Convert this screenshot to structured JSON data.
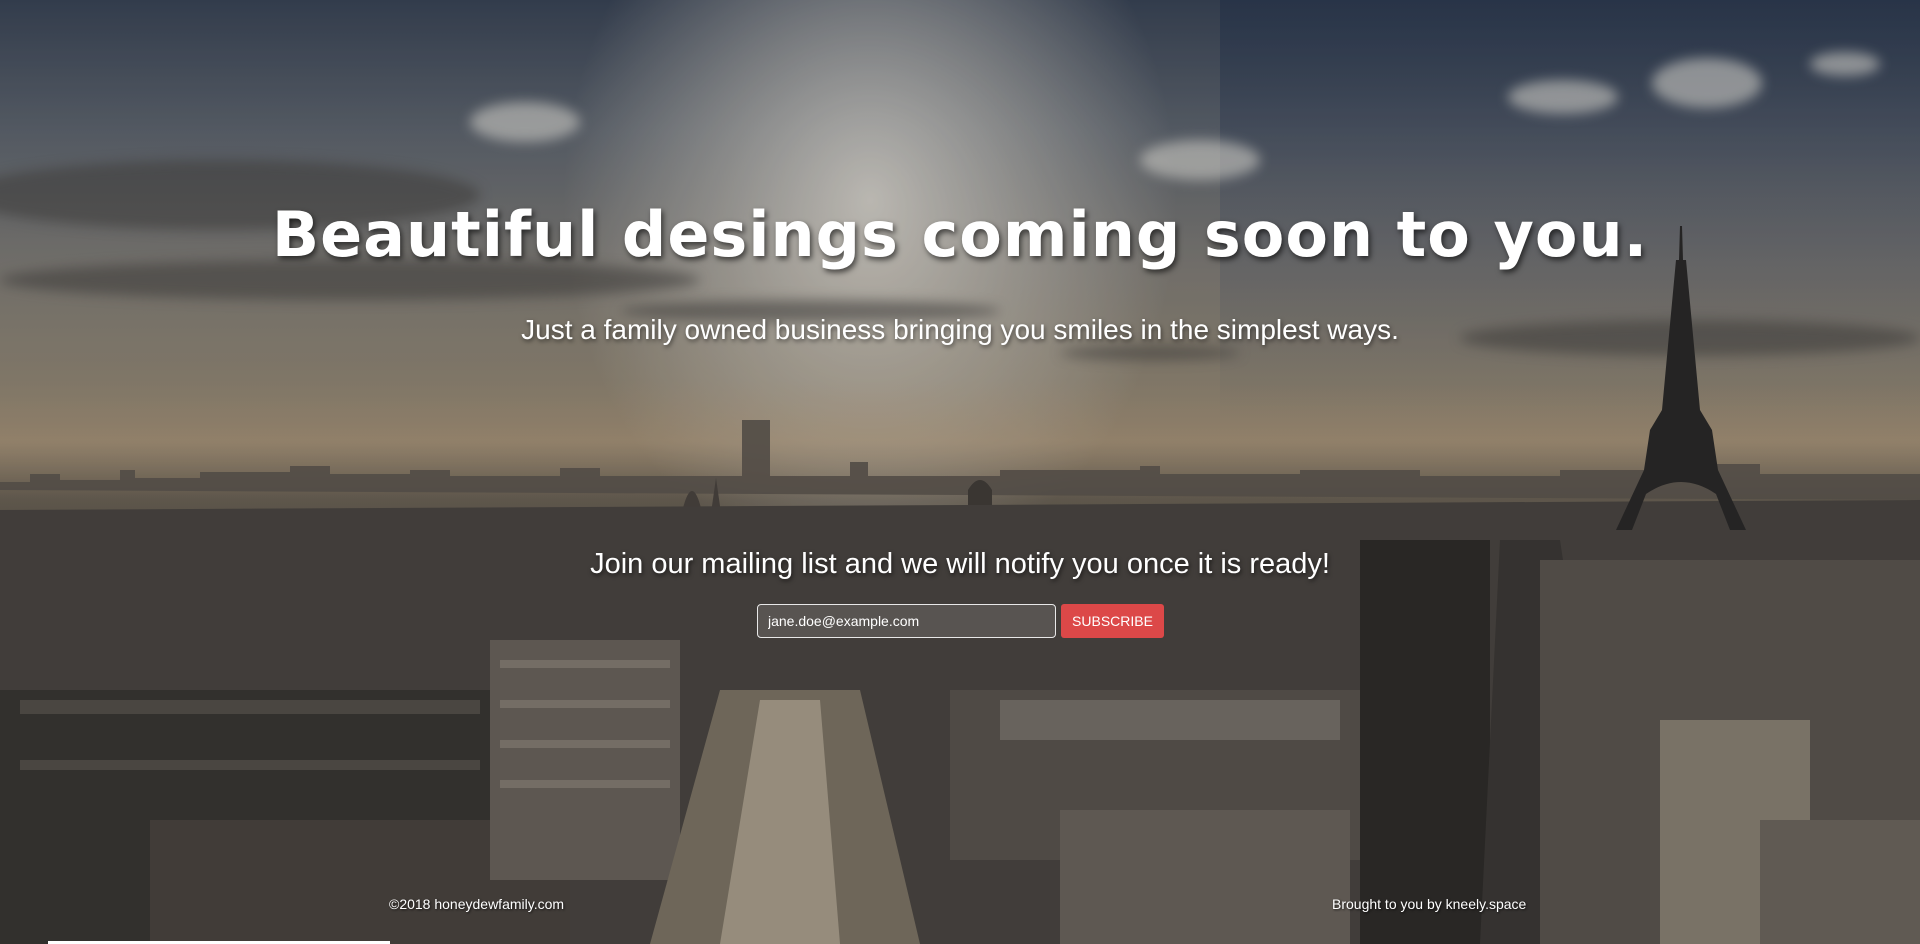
{
  "hero": {
    "title": "Beautiful desings coming soon to you.",
    "subtitle": "Just a family owned business bringing you smiles in the simplest ways."
  },
  "mailing": {
    "title": "Join our mailing list and we will notify you once it is ready!",
    "email_value": "jane.doe@example.com",
    "subscribe_label": "SUBSCRIBE"
  },
  "footer": {
    "copyright": "©2018 honeydewfamily.com",
    "credit_prefix": "Brought to you by ",
    "credit_link": "kneely.space"
  },
  "colors": {
    "accent": "#dc4848",
    "text": "#ffffff"
  },
  "background": {
    "scene": "paris-skyline-eiffel-tower-photo"
  }
}
